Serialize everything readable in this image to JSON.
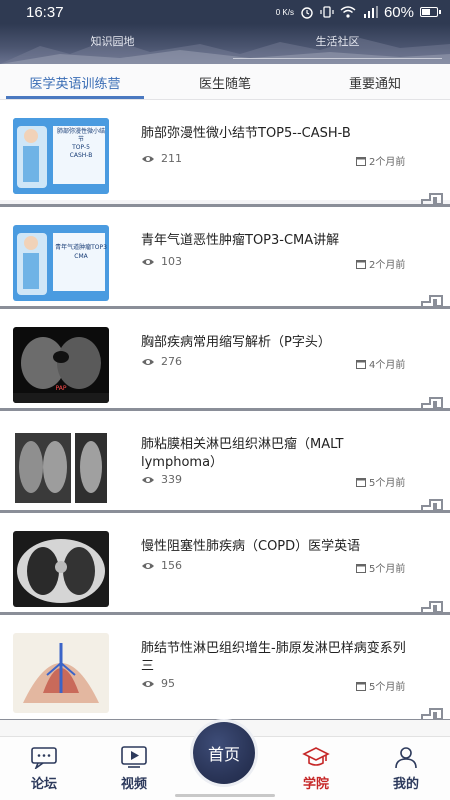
{
  "status_bar": {
    "time": "16:37",
    "speed": "0 K/s",
    "battery_percent": "60%",
    "battery_level": 0.6
  },
  "top_tabs": [
    {
      "label": "知识园地",
      "active": false
    },
    {
      "label": "生活社区",
      "active": true
    }
  ],
  "sub_tabs": [
    {
      "label": "医学英语训练营",
      "active": true
    },
    {
      "label": "医生随笔",
      "active": false
    },
    {
      "label": "重要通知",
      "active": false
    }
  ],
  "articles": [
    {
      "title": "肺部弥漫性微小结节TOP5--CASH-B",
      "views": "211",
      "date": "2个月前",
      "thumb": "slide-blue"
    },
    {
      "title": "青年气道恶性肿瘤TOP3-CMA讲解",
      "views": "103",
      "date": "2个月前",
      "thumb": "slide-blue"
    },
    {
      "title": "胸部疾病常用缩写解析（P字头）",
      "views": "276",
      "date": "4个月前",
      "thumb": "ct-dark"
    },
    {
      "title": "肺粘膜相关淋巴组织淋巴瘤（MALT lymphoma）",
      "views": "339",
      "date": "5个月前",
      "thumb": "xray"
    },
    {
      "title": "慢性阻塞性肺疾病（COPD）医学英语",
      "views": "156",
      "date": "5个月前",
      "thumb": "ct-light"
    },
    {
      "title": "肺结节性淋巴组织增生-肺原发淋巴样病变系列三",
      "views": "95",
      "date": "5个月前",
      "thumb": "diagram"
    }
  ],
  "thumb_text": {
    "card1_line1": "肺部弥漫性微小结节",
    "card1_line2": "TOP-5",
    "card1_line3": "CASH-B",
    "card2_line1": "青年气道肿瘤TOP3",
    "card2_line2": "CMA",
    "card3_caption": "PAP"
  },
  "bottom_nav": {
    "forum": "论坛",
    "video": "视频",
    "home": "首页",
    "academy": "学院",
    "mine": "我的",
    "active": "academy"
  },
  "colors": {
    "accent": "#4a78c0",
    "nav_active": "#c62828",
    "nav_text": "#2d3a5c",
    "header_bg": "#2f3a52"
  },
  "icons": {
    "views": "eye-icon",
    "date": "calendar-icon",
    "forum": "chat-bubble-icon",
    "video": "video-play-icon",
    "academy": "graduation-cap-icon",
    "mine": "user-icon"
  }
}
